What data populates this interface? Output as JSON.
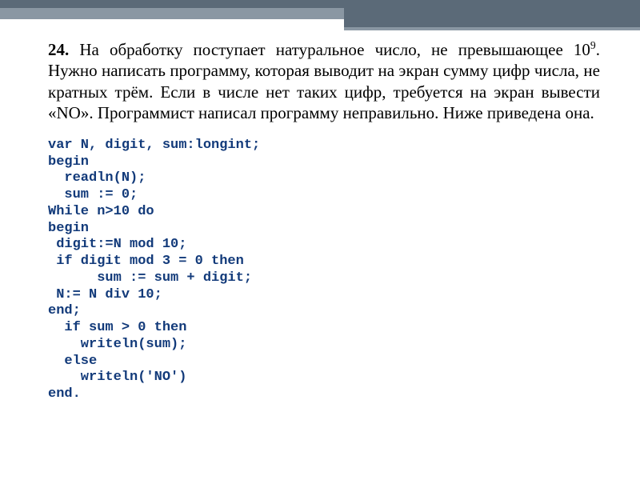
{
  "problem": {
    "number": "24.",
    "text_html": "На обработку поступает натуральное число, не превышающее 10<sup>9</sup>. Нужно написать программу, которая выводит на экран сумму цифр числа, не кратных трём. Если в числе нет таких цифр, требуется на экран вывести «NO».  Программист написал программу неправильно. Ниже приведена она."
  },
  "code": {
    "lines": [
      "var N, digit, sum:longint;",
      "begin",
      "  readln(N);",
      "  sum := 0;",
      "While n>10 do",
      "begin",
      " digit:=N mod 10;",
      " if digit mod 3 = 0 then",
      "      sum := sum + digit;",
      " N:= N div 10;",
      "end;",
      "  if sum > 0 then",
      "    writeln(sum);",
      "  else",
      "    writeln('NO')",
      "end."
    ]
  }
}
